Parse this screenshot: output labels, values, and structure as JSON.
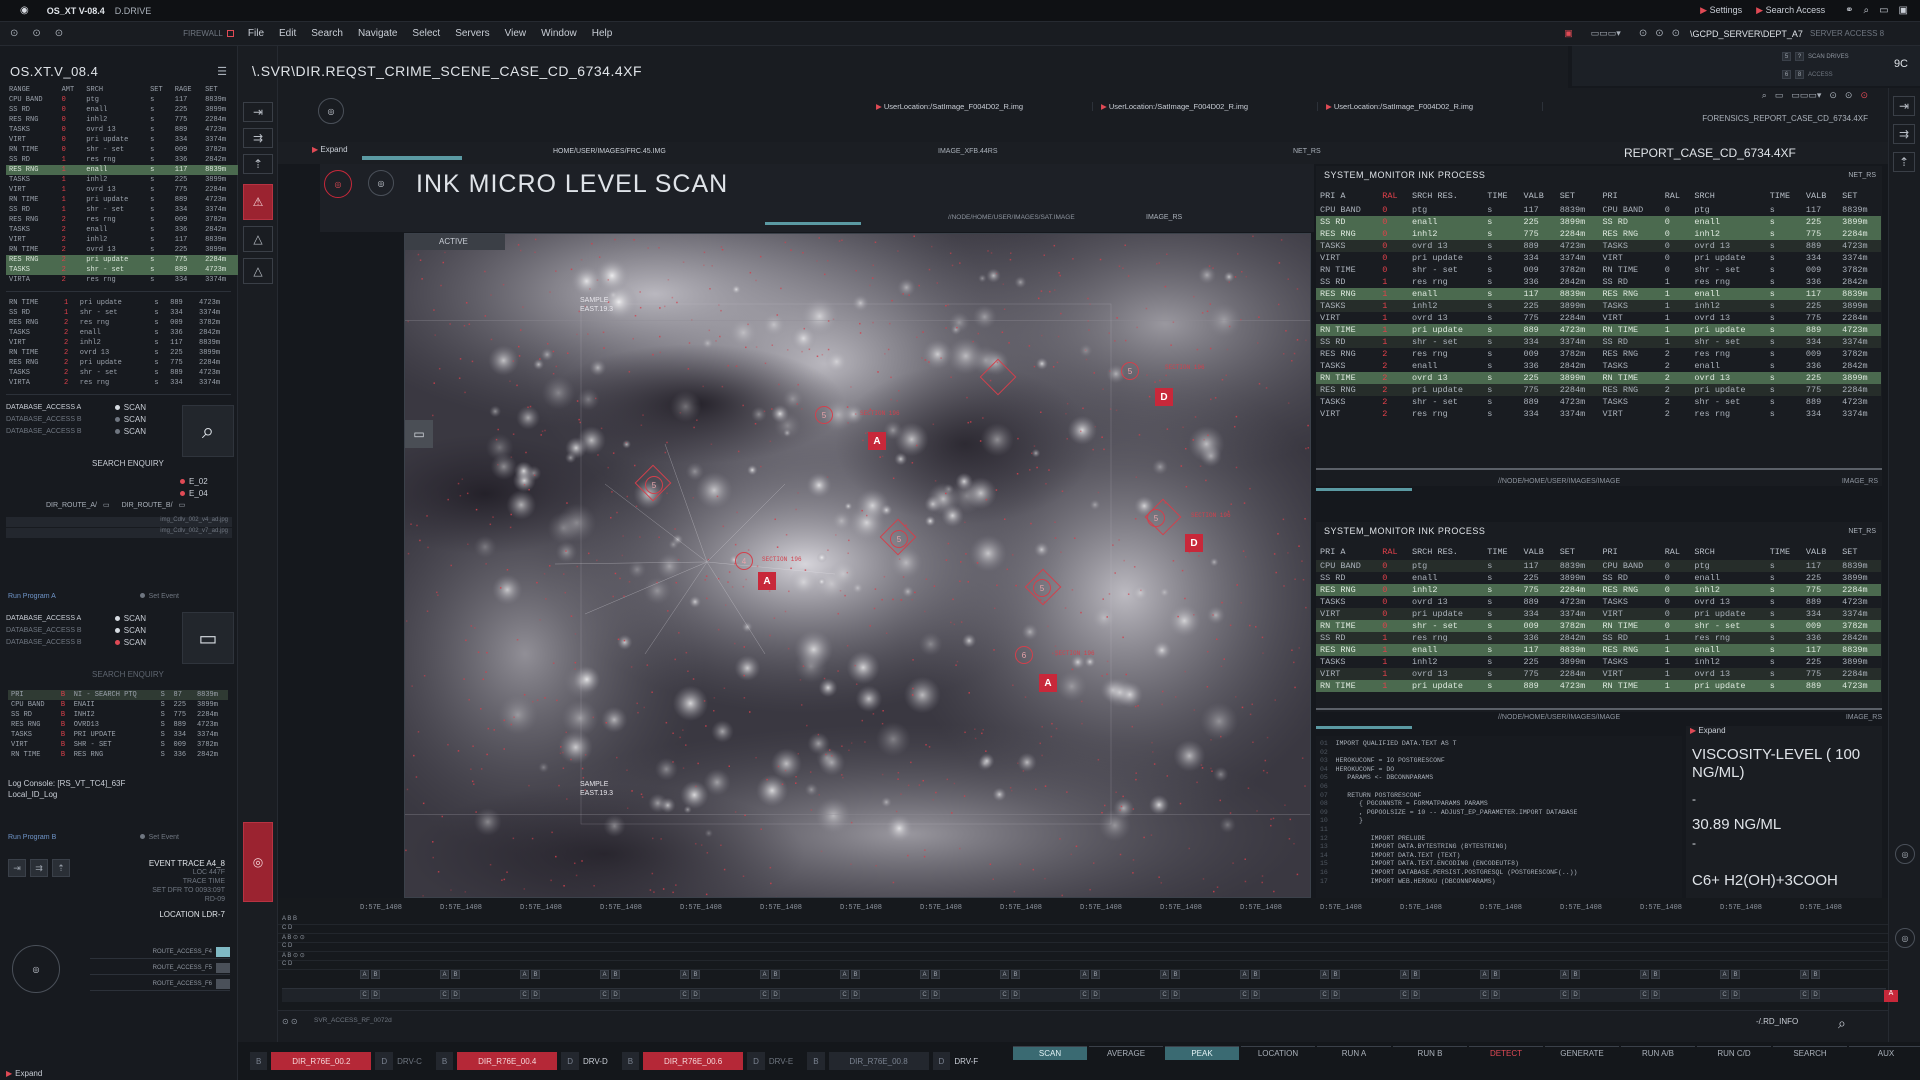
{
  "topbar": {
    "os_label": "OS_XT V-08.4",
    "drive": "D.DRIVE",
    "firewall": "FIREWALL",
    "settings": "Settings",
    "search_access": "Search Access"
  },
  "menu": [
    "File",
    "Edit",
    "Search",
    "Navigate",
    "Select",
    "Servers",
    "View",
    "Window",
    "Help"
  ],
  "server": {
    "path": "\\GCPD_SERVER\\DEPT_A7",
    "access": "SERVER ACCESS 8",
    "scan_drives": "SCAN DRIVES",
    "access2": "ACCESS",
    "code": "9C"
  },
  "left": {
    "title": "OS.XT.V_08.4",
    "headers": [
      "RANGE",
      "AMT",
      "SRCH",
      "SET",
      "RAGE",
      "SET"
    ],
    "rows1": [
      [
        "CPU BAND",
        "0",
        "ptg",
        "s",
        "117",
        "8839m"
      ],
      [
        "SS RD",
        "0",
        "enall",
        "s",
        "225",
        "3899m"
      ],
      [
        "RES RNG",
        "0",
        "inhl2",
        "s",
        "775",
        "2284m"
      ],
      [
        "TASKS",
        "0",
        "ovrd 13",
        "s",
        "889",
        "4723m"
      ],
      [
        "VIRT",
        "0",
        "pri update",
        "s",
        "334",
        "3374m"
      ],
      [
        "RN TIME",
        "0",
        "shr - set",
        "s",
        "009",
        "3782m"
      ],
      [
        "SS RD",
        "1",
        "res rng",
        "s",
        "336",
        "2842m"
      ],
      [
        "RES RNG",
        "1",
        "enall",
        "s",
        "117",
        "8839m"
      ],
      [
        "TASKS",
        "1",
        "inhl2",
        "s",
        "225",
        "3899m"
      ],
      [
        "VIRT",
        "1",
        "ovrd 13",
        "s",
        "775",
        "2284m"
      ],
      [
        "RN TIME",
        "1",
        "pri update",
        "s",
        "889",
        "4723m"
      ],
      [
        "SS RD",
        "1",
        "shr - set",
        "s",
        "334",
        "3374m"
      ],
      [
        "RES RNG",
        "2",
        "res rng",
        "s",
        "009",
        "3782m"
      ],
      [
        "TASKS",
        "2",
        "enall",
        "s",
        "336",
        "2842m"
      ],
      [
        "VIRT",
        "2",
        "inhl2",
        "s",
        "117",
        "8839m"
      ],
      [
        "RN TIME",
        "2",
        "ovrd 13",
        "s",
        "225",
        "3899m"
      ],
      [
        "RES RNG",
        "2",
        "pri update",
        "s",
        "775",
        "2284m"
      ],
      [
        "TASKS",
        "2",
        "shr - set",
        "s",
        "889",
        "4723m"
      ],
      [
        "VIRTA",
        "2",
        "res rng",
        "s",
        "334",
        "3374m"
      ]
    ],
    "rows2": [
      [
        "RN TIME",
        "1",
        "pri update",
        "s",
        "889",
        "4723m"
      ],
      [
        "SS RD",
        "1",
        "shr - set",
        "s",
        "334",
        "3374m"
      ],
      [
        "RES RNG",
        "2",
        "res rng",
        "s",
        "009",
        "3782m"
      ],
      [
        "TASKS",
        "2",
        "enall",
        "s",
        "336",
        "2842m"
      ],
      [
        "VIRT",
        "2",
        "inhl2",
        "s",
        "117",
        "8839m"
      ],
      [
        "RN TIME",
        "2",
        "ovrd 13",
        "s",
        "225",
        "3899m"
      ],
      [
        "RES RNG",
        "2",
        "pri update",
        "s",
        "775",
        "2284m"
      ],
      [
        "TASKS",
        "2",
        "shr - set",
        "s",
        "889",
        "4723m"
      ],
      [
        "VIRTA",
        "2",
        "res rng",
        "s",
        "334",
        "3374m"
      ]
    ],
    "db": [
      [
        "DATABASE_ACCESS A",
        "SCAN"
      ],
      [
        "DATABASE_ACCESS B",
        "SCAN"
      ],
      [
        "DATABASE_ACCESS B",
        "SCAN"
      ]
    ],
    "search_enquiry": "SEARCH ENQUIRY",
    "e_items": [
      "E_02",
      "E_04"
    ],
    "dir_a": "DIR_ROUTE_A/",
    "dir_b": "DIR_ROUTE_B/",
    "files": [
      "img_Cdlv_002_v4_ad.jpg",
      "img_Cdlv_002_v7_ad.jpg"
    ],
    "run_a": "Run Program A",
    "set_event": "Set Event",
    "db2": [
      [
        "DATABASE_ACCESS A",
        "SCAN"
      ],
      [
        "DATABASE_ACCESS B",
        "SCAN"
      ],
      [
        "DATABASE_ACCESS B",
        "SCAN"
      ]
    ],
    "search_enquiry2": "SEARCH ENQUIRY",
    "mini_rows": [
      [
        "PRI",
        "B",
        "NI - SEARCH PTQ",
        "S",
        "87",
        "8839m"
      ],
      [
        "CPU BAND",
        "B",
        "ENAII",
        "S",
        "225",
        "3899m"
      ],
      [
        "SS RD",
        "B",
        "INHI2",
        "S",
        "775",
        "2284m"
      ],
      [
        "RES RNG",
        "B",
        "OVRD13",
        "S",
        "889",
        "4723m"
      ],
      [
        "TASKS",
        "B",
        "PRI UPDATE",
        "S",
        "334",
        "3374m"
      ],
      [
        "VIRT",
        "B",
        "SHR - SET",
        "S",
        "009",
        "3782m"
      ],
      [
        "RN TIME",
        "B",
        "RES RNG",
        "S",
        "336",
        "2842m"
      ]
    ],
    "log_console": "Log Console: [RS_VT_TC4]_63F",
    "local_log": "Local_ID_Log",
    "run_b": "Run Program B",
    "event_trace": "EVENT TRACE A4_8",
    "trace_lines": [
      "LOC 447F",
      "TRACE TIME",
      "SET DFR TO 0093:09T",
      "RD-09"
    ],
    "location": "LOCATION LDR-7",
    "routes": [
      "ROUTE_ACCESS_F4",
      "ROUTE_ACCESS_F5",
      "ROUTE_ACCESS_F6"
    ],
    "expand": "Expand"
  },
  "path": "\\.SVR\\DIR.REQST_CRIME_SCENE_CASE_CD_6734.4XF",
  "tabs": [
    "UserLocation:/SatImage_F004D02_R.img",
    "UserLocation:/SatImage_F004D02_R.img",
    "UserLocation:/SatImage_F004D02_R.img"
  ],
  "forensics": "FORENSICS_REPORT_CASE_CD_6734.4XF",
  "expand": "Expand",
  "subpaths": [
    "HOME/USER/IMAGES/FRC.45.IMG",
    "IMAGE_XFB.44RS",
    "NET_RS"
  ],
  "report_title": "REPORT_CASE_CD_6734.4XF",
  "scan_title": "INK MICRO LEVEL SCAN",
  "scan_subpath": "//NODE/HOME/USER/IMAGES/SAT.IMAGE",
  "image_rs": "IMAGE_RS",
  "active": "ACTIVE",
  "sample_top": [
    "SAMPLE",
    "EAST.19.3"
  ],
  "sample_bottom": [
    "SAMPLE",
    "EAST.19.3"
  ],
  "markers": [
    "A",
    "A",
    "A",
    "D",
    "D"
  ],
  "sections": [
    "SECTION 196",
    "SECTION 196",
    "SECTION 196",
    "SECTION 196",
    "SECTION 196"
  ],
  "monitor": {
    "title": "SYSTEM_MONITOR INK PROCESS",
    "net": "NET_RS",
    "headers": [
      "PRI A",
      "RAL",
      "SRCH RES.",
      "TIME",
      "VALB",
      "SET",
      "PRI",
      "RAL",
      "SRCH",
      "TIME",
      "VALB",
      "SET"
    ],
    "rows": [
      [
        "CPU BAND",
        "0",
        "ptg",
        "s",
        "117",
        "8839m",
        "CPU BAND",
        "0",
        "ptg",
        "s",
        "117",
        "8839m"
      ],
      [
        "SS RD",
        "0",
        "enall",
        "s",
        "225",
        "3899m",
        "SS RD",
        "0",
        "enall",
        "s",
        "225",
        "3899m"
      ],
      [
        "RES RNG",
        "0",
        "inhl2",
        "s",
        "775",
        "2284m",
        "RES RNG",
        "0",
        "inhl2",
        "s",
        "775",
        "2284m"
      ],
      [
        "TASKS",
        "0",
        "ovrd 13",
        "s",
        "889",
        "4723m",
        "TASKS",
        "0",
        "ovrd 13",
        "s",
        "889",
        "4723m"
      ],
      [
        "VIRT",
        "0",
        "pri update",
        "s",
        "334",
        "3374m",
        "VIRT",
        "0",
        "pri update",
        "s",
        "334",
        "3374m"
      ],
      [
        "RN TIME",
        "0",
        "shr - set",
        "s",
        "009",
        "3782m",
        "RN TIME",
        "0",
        "shr - set",
        "s",
        "009",
        "3782m"
      ],
      [
        "SS RD",
        "1",
        "res rng",
        "s",
        "336",
        "2842m",
        "SS RD",
        "1",
        "res rng",
        "s",
        "336",
        "2842m"
      ],
      [
        "RES RNG",
        "1",
        "enall",
        "s",
        "117",
        "8839m",
        "RES RNG",
        "1",
        "enall",
        "s",
        "117",
        "8839m"
      ],
      [
        "TASKS",
        "1",
        "inhl2",
        "s",
        "225",
        "3899m",
        "TASKS",
        "1",
        "inhl2",
        "s",
        "225",
        "3899m"
      ],
      [
        "VIRT",
        "1",
        "ovrd 13",
        "s",
        "775",
        "2284m",
        "VIRT",
        "1",
        "ovrd 13",
        "s",
        "775",
        "2284m"
      ],
      [
        "RN TIME",
        "1",
        "pri update",
        "s",
        "889",
        "4723m",
        "RN TIME",
        "1",
        "pri update",
        "s",
        "889",
        "4723m"
      ],
      [
        "SS RD",
        "1",
        "shr - set",
        "s",
        "334",
        "3374m",
        "SS RD",
        "1",
        "shr - set",
        "s",
        "334",
        "3374m"
      ],
      [
        "RES RNG",
        "2",
        "res rng",
        "s",
        "009",
        "3782m",
        "RES RNG",
        "2",
        "res rng",
        "s",
        "009",
        "3782m"
      ],
      [
        "TASKS",
        "2",
        "enall",
        "s",
        "336",
        "2842m",
        "TASKS",
        "2",
        "enall",
        "s",
        "336",
        "2842m"
      ],
      [
        "RN TIME",
        "2",
        "ovrd 13",
        "s",
        "225",
        "3899m",
        "RN TIME",
        "2",
        "ovrd 13",
        "s",
        "225",
        "3899m"
      ],
      [
        "RES RNG",
        "2",
        "pri update",
        "s",
        "775",
        "2284m",
        "RES RNG",
        "2",
        "pri update",
        "s",
        "775",
        "2284m"
      ],
      [
        "TASKS",
        "2",
        "shr - set",
        "s",
        "889",
        "4723m",
        "TASKS",
        "2",
        "shr - set",
        "s",
        "889",
        "4723m"
      ],
      [
        "VIRT",
        "2",
        "res rng",
        "s",
        "334",
        "3374m",
        "VIRT",
        "2",
        "res rng",
        "s",
        "334",
        "3374m"
      ]
    ],
    "path": "//NODE/HOME/USER/IMAGES/IMAGE",
    "image_rs": "IMAGE_RS"
  },
  "monitor2": {
    "title": "SYSTEM_MONITOR INK PROCESS",
    "net": "NET_RS",
    "path": "//NODE/HOME/USER/IMAGES/IMAGE",
    "image_rs": "IMAGE_RS",
    "rows": [
      [
        "CPU BAND",
        "0",
        "ptg",
        "s",
        "117",
        "8839m",
        "CPU BAND",
        "0",
        "ptg",
        "s",
        "117",
        "8839m"
      ],
      [
        "SS RD",
        "0",
        "enall",
        "s",
        "225",
        "3899m",
        "SS RD",
        "0",
        "enall",
        "s",
        "225",
        "3899m"
      ],
      [
        "RES RNG",
        "0",
        "inhl2",
        "s",
        "775",
        "2284m",
        "RES RNG",
        "0",
        "inhl2",
        "s",
        "775",
        "2284m"
      ],
      [
        "TASKS",
        "0",
        "ovrd 13",
        "s",
        "889",
        "4723m",
        "TASKS",
        "0",
        "ovrd 13",
        "s",
        "889",
        "4723m"
      ],
      [
        "VIRT",
        "0",
        "pri update",
        "s",
        "334",
        "3374m",
        "VIRT",
        "0",
        "pri update",
        "s",
        "334",
        "3374m"
      ],
      [
        "RN TIME",
        "0",
        "shr - set",
        "s",
        "009",
        "3782m",
        "RN TIME",
        "0",
        "shr - set",
        "s",
        "009",
        "3782m"
      ],
      [
        "SS RD",
        "1",
        "res rng",
        "s",
        "336",
        "2842m",
        "SS RD",
        "1",
        "res rng",
        "s",
        "336",
        "2842m"
      ],
      [
        "RES RNG",
        "1",
        "enall",
        "s",
        "117",
        "8839m",
        "RES RNG",
        "1",
        "enall",
        "s",
        "117",
        "8839m"
      ],
      [
        "TASKS",
        "1",
        "inhl2",
        "s",
        "225",
        "3899m",
        "TASKS",
        "1",
        "inhl2",
        "s",
        "225",
        "3899m"
      ],
      [
        "VIRT",
        "1",
        "ovrd 13",
        "s",
        "775",
        "2284m",
        "VIRT",
        "1",
        "ovrd 13",
        "s",
        "775",
        "2284m"
      ],
      [
        "RN TIME",
        "1",
        "pri update",
        "s",
        "889",
        "4723m",
        "RN TIME",
        "1",
        "pri update",
        "s",
        "889",
        "4723m"
      ]
    ]
  },
  "code": {
    "lines": [
      "IMPORT QUALIFIED DATA.TEXT AS T",
      "",
      "HEROKUCONF = IO POSTGRESCONF",
      "HEROKUCONF = DO",
      "   PARAMS <- DBCONNPARAMS",
      "",
      "   RETURN POSTGRESCONF",
      "      { PGCONNSTR = FORMATPARAMS PARAMS",
      "      , PGPOOLSIZE = 10 -- ADJUST_EP_PARAMETER.IMPORT DATABASE",
      "      }",
      "",
      "         IMPORT PRELUDE",
      "         IMPORT DATA.BYTESTRING (BYTESTRING)",
      "         IMPORT DATA.TEXT (TEXT)",
      "         IMPORT DATA.TEXT.ENCODING (ENCODEUTF8)",
      "         IMPORT DATABASE.PERSIST.POSTGRESQL (POSTGRESCONF(..))",
      "         IMPORT WEB.HEROKU (DBCONNPARAMS)"
    ]
  },
  "viscosity": {
    "label": "VISCOSITY-LEVEL ( 100 NG/ML)",
    "dash": "-",
    "value": "30.89 NG/ML",
    "dash2": "-",
    "formula": "C6+  H2(OH)+3COOH",
    "expand": "Expand"
  },
  "timeline": {
    "tick": "D:57E_1408",
    "count": 19,
    "bar_label": "SVR_ACCESS_RF_0072d",
    "rd_info": "-/.RD_INFO"
  },
  "bottom_tabs": [
    "SCAN",
    "AVERAGE",
    "PEAK",
    "LOCATION",
    "RUN A",
    "RUN B",
    "DETECT",
    "GENERATE",
    "RUN A/B",
    "RUN C/D",
    "SEARCH",
    "AUX"
  ],
  "drives": [
    [
      "B",
      "DIR_R76E_00.2",
      "D",
      "DRV-C"
    ],
    [
      "B",
      "DIR_R76E_00.4",
      "D",
      "DRV-D"
    ],
    [
      "B",
      "DIR_R76E_00.6",
      "D",
      "DRV-E"
    ],
    [
      "B",
      "DIR_R76E_00.8",
      "D",
      "DRV-F"
    ]
  ],
  "colors": {
    "accent_red": "#c8283a",
    "highlight_green": "#4b6a4f",
    "teal": "#3a6a72"
  }
}
